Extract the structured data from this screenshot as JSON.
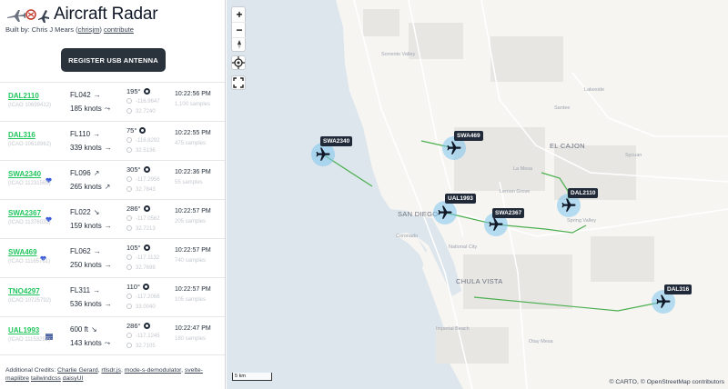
{
  "app": {
    "title": "Aircraft Radar",
    "byline_prefix": "Built by: Chris J Mears (",
    "byline_handle": "chrisjm",
    "byline_mid": ") ",
    "byline_link": "contribute",
    "register_button": "REGISTER USB ANTENNA"
  },
  "flights": [
    {
      "callsign": "DAL2110",
      "badge": "",
      "icao": "(ICAO 10699412)",
      "altitude": "FL042",
      "alt_trend": "→",
      "speed": "185 knots",
      "spd_trend": "⤳",
      "heading": "195°",
      "lon": "-116.9647",
      "lat": "32.7240",
      "time": "10:22:56 PM",
      "samples": "1,100 samples"
    },
    {
      "callsign": "DAL316",
      "badge": "",
      "icao": "(ICAO 10618962)",
      "altitude": "FL110",
      "alt_trend": "→",
      "speed": "339 knots",
      "spd_trend": "→",
      "heading": "75°",
      "lon": "-116.8292",
      "lat": "32.5136",
      "time": "10:22:55 PM",
      "samples": "475 samples"
    },
    {
      "callsign": "SWA2340",
      "badge": "heart",
      "icao": "(ICAO 11231569)",
      "altitude": "FL096",
      "alt_trend": "↗",
      "speed": "265 knots",
      "spd_trend": "↗",
      "heading": "305°",
      "lon": "-117.2956",
      "lat": "32.7843",
      "time": "10:22:36 PM",
      "samples": "55 samples"
    },
    {
      "callsign": "SWA2367",
      "badge": "heart",
      "icao": "(ICAO 11376031)",
      "altitude": "FL022",
      "alt_trend": "↘",
      "speed": "159 knots",
      "spd_trend": "→",
      "heading": "286°",
      "lon": "-117.0562",
      "lat": "32.7213",
      "time": "10:22:57 PM",
      "samples": "205 samples"
    },
    {
      "callsign": "SWA469",
      "badge": "heart",
      "icao": "(ICAO 11165761)",
      "altitude": "FL062",
      "alt_trend": "→",
      "speed": "250 knots",
      "spd_trend": "→",
      "heading": "105°",
      "lon": "-117.1132",
      "lat": "32.7698",
      "time": "10:22:57 PM",
      "samples": "740 samples"
    },
    {
      "callsign": "TNO4297",
      "badge": "",
      "icao": "(ICAO 10725792)",
      "altitude": "FL311",
      "alt_trend": "→",
      "speed": "536 knots",
      "spd_trend": "→",
      "heading": "110°",
      "lon": "-117.2066",
      "lat": "33.0040",
      "time": "10:22:57 PM",
      "samples": "105 samples"
    },
    {
      "callsign": "UAL1993",
      "badge": "flag",
      "icao": "(ICAO 11153292)",
      "altitude": "600 ft",
      "alt_trend": "↘",
      "speed": "143 knots",
      "spd_trend": "⤳",
      "heading": "286°",
      "lon": "-117.1245",
      "lat": "32.7105",
      "time": "10:22:47 PM",
      "samples": "180 samples"
    }
  ],
  "credits": {
    "prefix": "Additional Credits: ",
    "links": [
      "Charlie Gerard",
      "rtlsdr.js",
      "mode-s-demodulator",
      "svelte-maplibre",
      "tailwindcss",
      "daisyUI"
    ]
  },
  "map": {
    "labels": {
      "sorrento_valley": "Sorrento Valley",
      "lakeside": "Lakeside",
      "el_cajon": "EL CAJON",
      "la_mesa": "La Mesa",
      "lemon_grove": "Lemon Grove",
      "san_diego": "SAN DIEGO",
      "coronado": "Coronado",
      "national_city": "National City",
      "chula_vista": "CHULA VISTA",
      "imperial_beach": "Imperial Beach",
      "santee": "Santee",
      "sycuan": "Sycuan",
      "otay_mesa": "Otay Mesa",
      "spring_valley": "Spring Valley"
    },
    "planes": [
      {
        "callsign": "SWA2340"
      },
      {
        "callsign": "SWA469"
      },
      {
        "callsign": "UAL1993"
      },
      {
        "callsign": "SWA2367"
      },
      {
        "callsign": "DAL2110"
      },
      {
        "callsign": "DAL316"
      }
    ],
    "scale": "5 km",
    "attribution": "© CARTO, © OpenStreetMap contributors",
    "zoom_in": "+",
    "zoom_out": "−",
    "colors": {
      "track": "#4caf50",
      "plane_halo": "#7dc5ee",
      "water": "#dde6ec",
      "land": "#f6f5f2"
    }
  }
}
